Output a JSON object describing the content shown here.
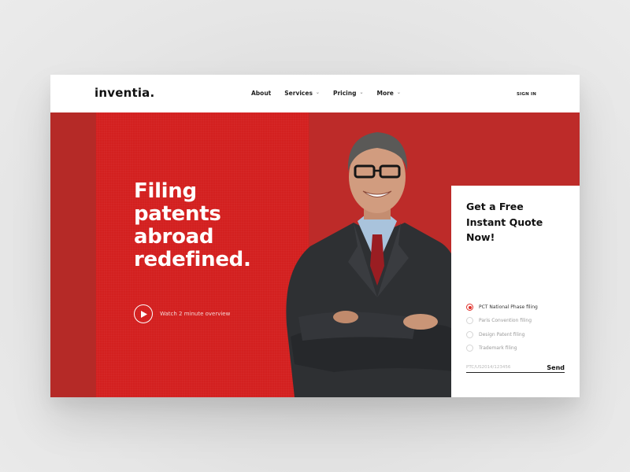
{
  "header": {
    "logo": "inventia.",
    "nav": [
      {
        "label": "About",
        "has_dropdown": false
      },
      {
        "label": "Services",
        "has_dropdown": true
      },
      {
        "label": "Pricing",
        "has_dropdown": true
      },
      {
        "label": "More",
        "has_dropdown": true
      }
    ],
    "chevron_glyph": "⌄",
    "sign_in": "SIGN IN"
  },
  "hero": {
    "headline_lines": [
      "Filing",
      "patents",
      "abroad",
      "redefined."
    ],
    "watch_label": "Watch 2 minute overview",
    "play_icon": "play-icon",
    "image_subject": "smiling businessman with glasses, arms crossed"
  },
  "quote": {
    "title_lines": [
      "Get a Free",
      "Instant Quote",
      "Now!"
    ],
    "options": [
      {
        "label": "PCT National Phase filing",
        "checked": true
      },
      {
        "label": "Paris Convention filing",
        "checked": false
      },
      {
        "label": "Design Patent filing",
        "checked": false
      },
      {
        "label": "Trademark filing",
        "checked": false
      }
    ],
    "input_placeholder": "PTC/US2014/123456",
    "input_value": "",
    "send_label": "Send"
  },
  "colors": {
    "accent_red": "#d3201f",
    "dark_red": "#b82a28",
    "radio_active": "#e0302a",
    "text_dark": "#111111"
  }
}
